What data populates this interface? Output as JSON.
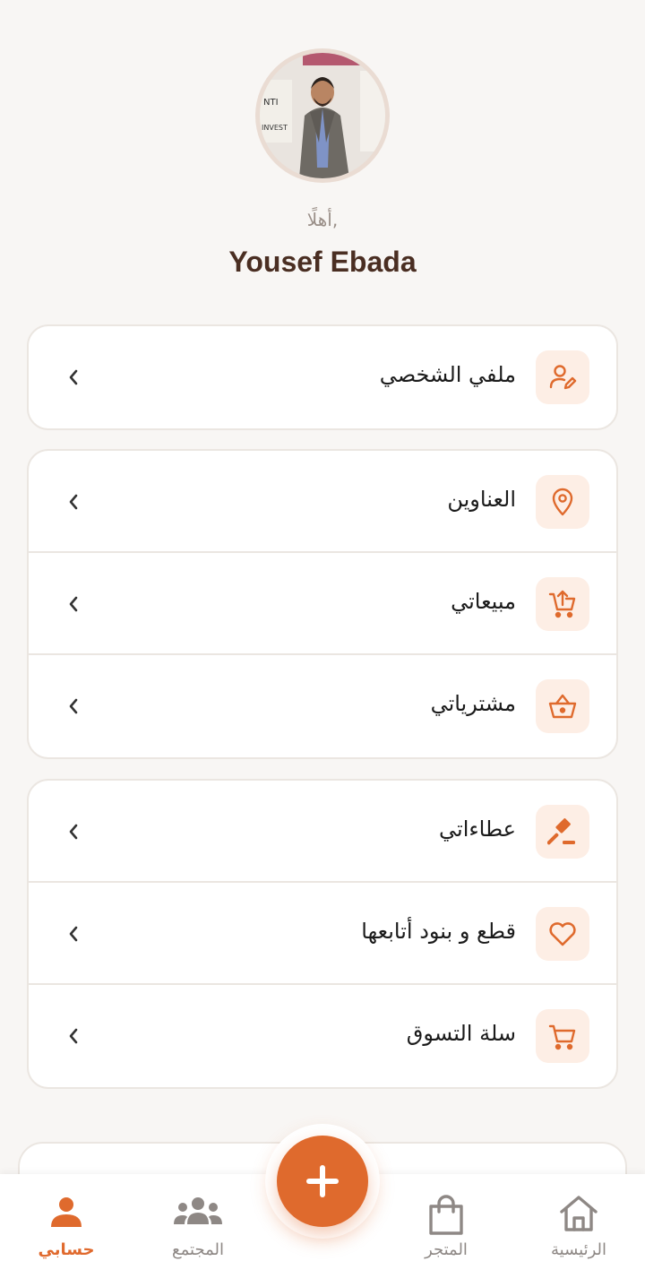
{
  "profile": {
    "greeting": "أهلًا,",
    "name": "Yousef Ebada"
  },
  "colors": {
    "accent": "#df6a2d",
    "icon_bg": "#fdeee5",
    "name_text": "#4a2e22",
    "background": "#f8f6f4"
  },
  "menu": {
    "profile": {
      "label": "ملفي الشخصي",
      "icon": "user-edit-icon"
    },
    "addresses": {
      "label": "العناوين",
      "icon": "location-pin-icon"
    },
    "sales": {
      "label": "مبيعاتي",
      "icon": "cart-upload-icon"
    },
    "purchases": {
      "label": "مشترياتي",
      "icon": "basket-icon"
    },
    "bids": {
      "label": "عطاءاتي",
      "icon": "gavel-icon"
    },
    "following": {
      "label": "قطع و بنود أتابعها",
      "icon": "heart-icon"
    },
    "cart": {
      "label": "سلة التسوق",
      "icon": "shopping-cart-icon"
    }
  },
  "nav": {
    "account": "حسابي",
    "community": "المجتمع",
    "store": "المتجر",
    "home": "الرئيسية",
    "active": "account"
  }
}
